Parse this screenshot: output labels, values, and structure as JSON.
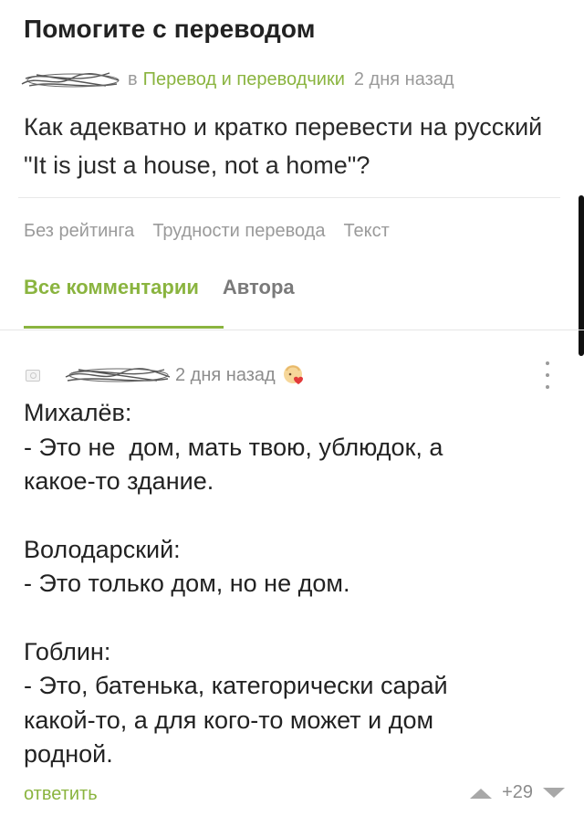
{
  "post": {
    "title": "Помогите с переводом",
    "in_label": "в",
    "community": "Перевод и переводчики",
    "time": "2 дня назад",
    "body": "Как адекватно и кратко перевести на русский \"It is just a house, not a home\"?"
  },
  "tags": [
    "Без рейтинга",
    "Трудности перевода",
    "Текст"
  ],
  "tabs": {
    "all": "Все комментарии",
    "author": "Автора"
  },
  "comment": {
    "time": "2 дня назад",
    "paragraphs": [
      [
        "Михалёв:",
        "- Это не  дом, мать твою, ублюдок, а",
        "какое-то здание."
      ],
      [
        "Володарский:",
        "- Это только дом, но не дом."
      ],
      [
        "Гоблин:",
        "- Это, батенька, категорически сарай",
        "какой-то, а для кого-то может и дом",
        "родной."
      ]
    ],
    "reply": "ответить",
    "score": "+29"
  },
  "colors": {
    "accent": "#8ab43f",
    "muted": "#9a9a9a",
    "text": "#222222"
  },
  "icons": {
    "avatar": "camera-placeholder-icon",
    "badge": "heart-emoji-icon",
    "more": "kebab-menu-icon",
    "upvote": "triangle-up-icon",
    "downvote": "triangle-down-icon"
  }
}
